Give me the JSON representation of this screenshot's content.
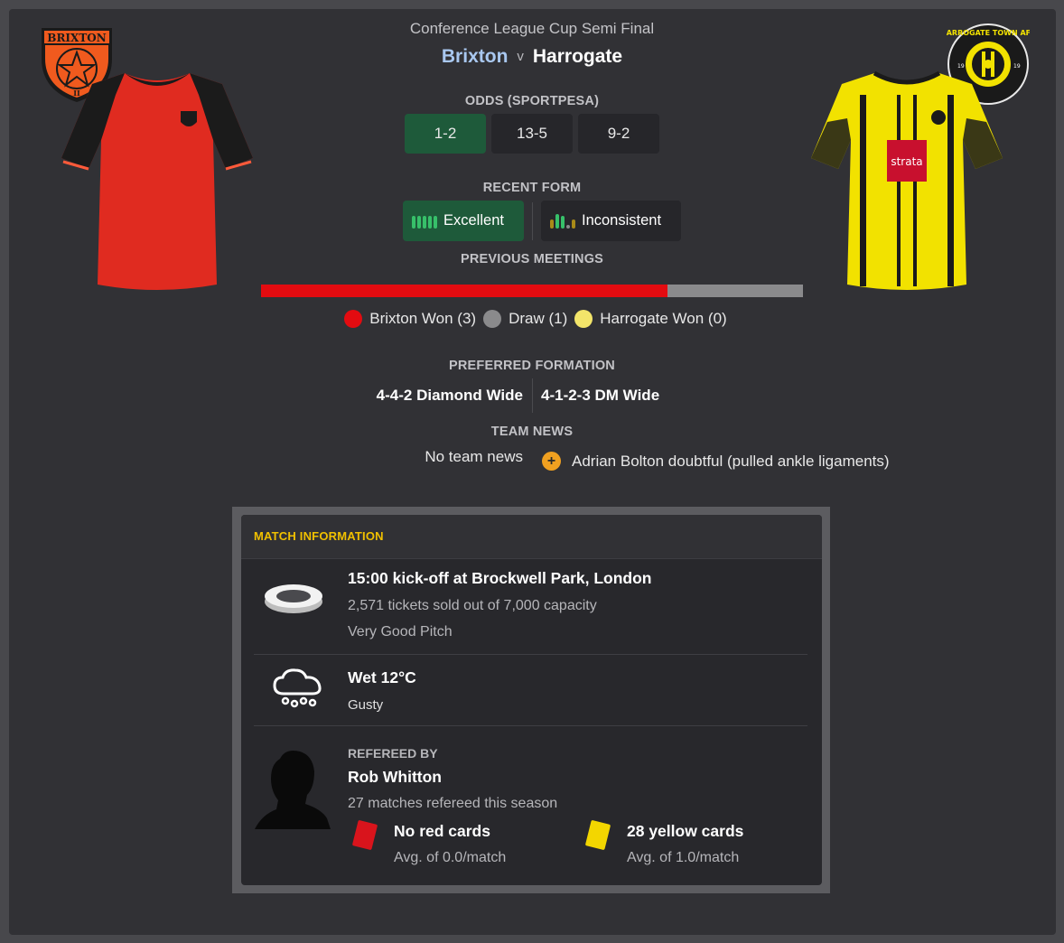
{
  "header": {
    "competition": "Conference League Cup Semi Final",
    "home_team": "Brixton",
    "versus": "v",
    "away_team": "Harrogate"
  },
  "home_badge": {
    "text": "BRIXTON",
    "sub": "II",
    "color": "#f05a1e"
  },
  "away_badge": {
    "ring_text": "HARROGATE TOWN AFC",
    "year_left": "19",
    "year_right": "19"
  },
  "away_kit": {
    "sponsor": "strata"
  },
  "odds": {
    "label": "ODDS (SPORTPESA)",
    "home": "1-2",
    "draw": "13-5",
    "away": "9-2"
  },
  "recent_form": {
    "label": "RECENT FORM",
    "home": "Excellent",
    "away": "Inconsistent"
  },
  "previous_meetings": {
    "label": "PREVIOUS MEETINGS",
    "home_won": 3,
    "draw": 1,
    "away_won": 0,
    "home_label": "Brixton Won (3)",
    "draw_label": "Draw (1)",
    "away_label": "Harrogate Won (0)",
    "colors": {
      "home": "#e30b10",
      "draw": "#8a8a8c",
      "away": "#f3e56a"
    }
  },
  "formation": {
    "label": "PREFERRED FORMATION",
    "home": "4-4-2 Diamond Wide",
    "away": "4-1-2-3 DM Wide"
  },
  "team_news": {
    "label": "TEAM NEWS",
    "home": "No team news",
    "away": "Adrian Bolton doubtful (pulled ankle ligaments)"
  },
  "match_info": {
    "title": "MATCH INFORMATION",
    "venue": {
      "kickoff": "15:00 kick-off at Brockwell Park, London",
      "tickets": "2,571 tickets sold out of 7,000 capacity",
      "pitch": "Very Good Pitch"
    },
    "weather": {
      "condition": "Wet 12°C",
      "wind": "Gusty"
    },
    "referee": {
      "caption": "REFEREED BY",
      "name": "Rob Whitton",
      "matches": "27 matches refereed this season",
      "red_cards": "No red cards",
      "red_avg": "Avg. of 0.0/match",
      "yellow_cards": "28 yellow cards",
      "yellow_avg": "Avg. of 1.0/match"
    }
  },
  "colors": {
    "accent_green": "#1e5a3a",
    "section_title": "#f0c000",
    "home_link": "#a9c8f0"
  }
}
